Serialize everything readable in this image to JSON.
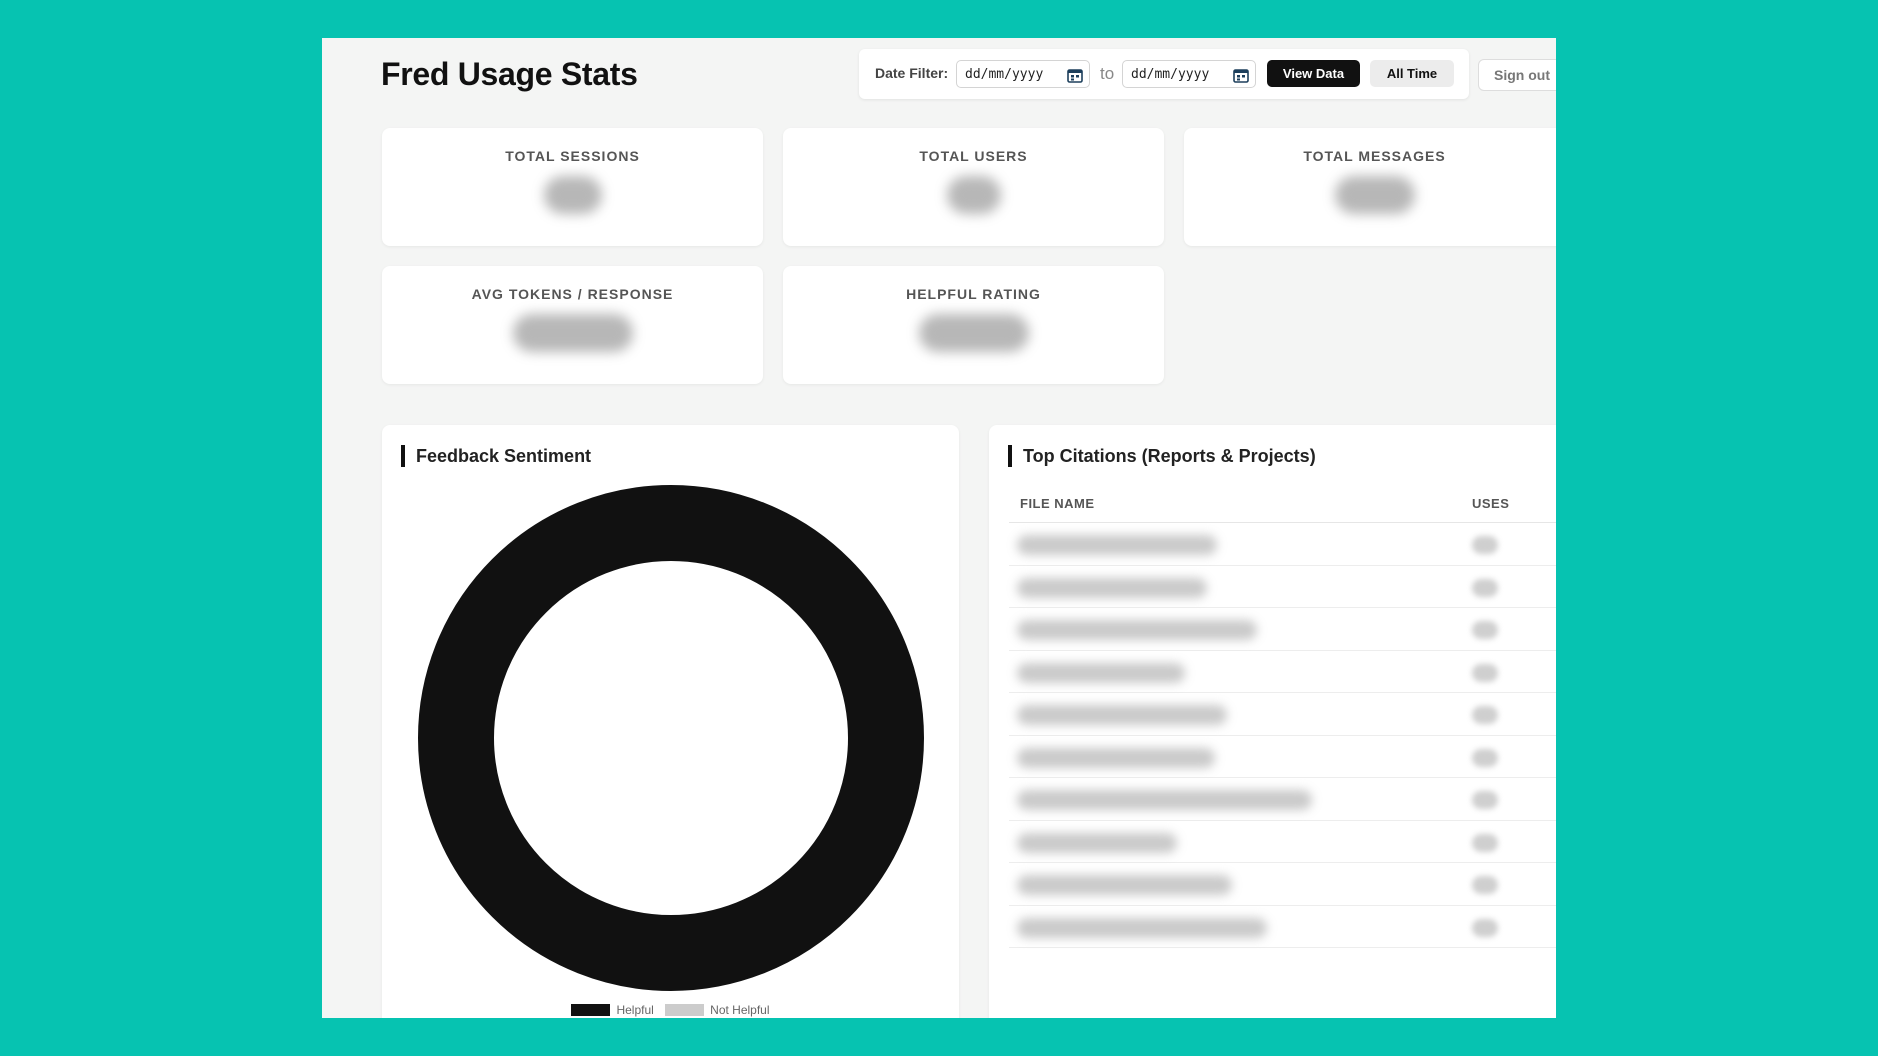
{
  "header": {
    "title": "Fred Usage Stats",
    "date_filter_label": "Date Filter:",
    "from_placeholder": "dd/mm/yyyy",
    "to_label": "to",
    "to_placeholder": "dd/mm/yyyy",
    "view_data_label": "View Data",
    "all_time_label": "All Time",
    "sign_out_label": "Sign out"
  },
  "stats": [
    {
      "label": "TOTAL SESSIONS"
    },
    {
      "label": "TOTAL USERS"
    },
    {
      "label": "TOTAL MESSAGES"
    },
    {
      "label": "AVG TOKENS / RESPONSE"
    },
    {
      "label": "HELPFUL RATING"
    }
  ],
  "sentiment": {
    "title": "Feedback Sentiment",
    "legend": [
      {
        "label": "Helpful",
        "color": "#111111"
      },
      {
        "label": "Not Helpful",
        "color": "#cccccc"
      }
    ]
  },
  "citations": {
    "title": "Top Citations (Reports & Projects)",
    "columns": [
      "FILE NAME",
      "USES"
    ],
    "row_count": 10
  }
}
